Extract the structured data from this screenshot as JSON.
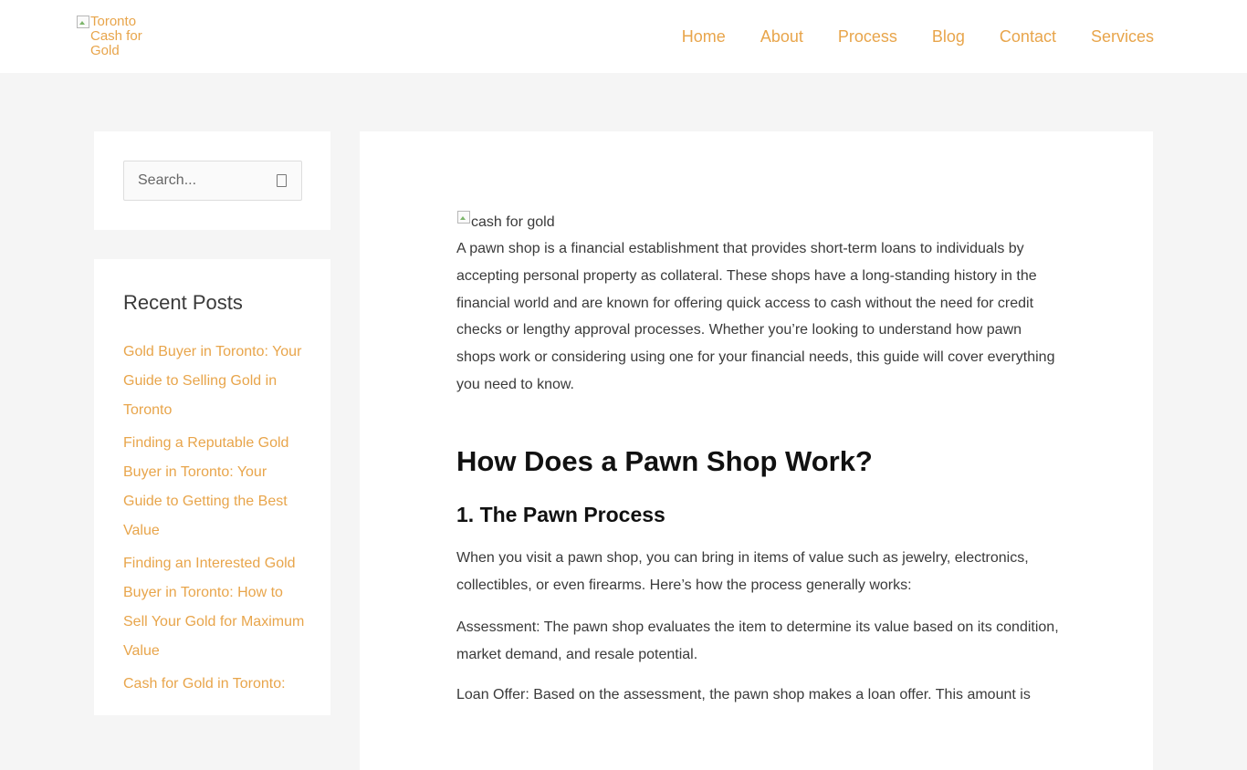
{
  "header": {
    "logo_alt": "Toronto Cash for Gold",
    "nav": [
      "Home",
      "About",
      "Process",
      "Blog",
      "Contact",
      "Services"
    ]
  },
  "sidebar": {
    "search_placeholder": "Search...",
    "recent_title": "Recent Posts",
    "recent_posts": [
      "Gold Buyer in Toronto: Your Guide to Selling Gold in Toronto",
      "Finding a Reputable Gold Buyer in Toronto: Your Guide to Getting the Best Value",
      "Finding an Interested Gold Buyer in Toronto: How to Sell Your Gold for Maximum Value",
      "Cash for Gold in Toronto:"
    ]
  },
  "article": {
    "image_alt": "cash for gold",
    "intro": "A pawn shop is a financial establishment that provides short-term loans to individuals by accepting personal property as collateral. These shops have a long-standing history in the financial world and are known for offering quick access to cash without the need for credit checks or lengthy approval processes. Whether you’re looking to understand how pawn shops work or considering using one for your financial needs, this guide will cover everything you need to know.",
    "h2": "How Does a Pawn Shop Work?",
    "h3": "1. The Pawn Process",
    "p2": "When you visit a pawn shop, you can bring in items of value such as jewelry, electronics, collectibles, or even firearms. Here’s how the process generally works:",
    "p3": "Assessment: The pawn shop evaluates the item to determine its value based on its condition, market demand, and resale potential.",
    "p4": "Loan Offer: Based on the assessment, the pawn shop makes a loan offer. This amount is"
  },
  "colors": {
    "accent": "#e8a54b",
    "background": "#f5f5f5",
    "text": "#3a3a3a"
  }
}
